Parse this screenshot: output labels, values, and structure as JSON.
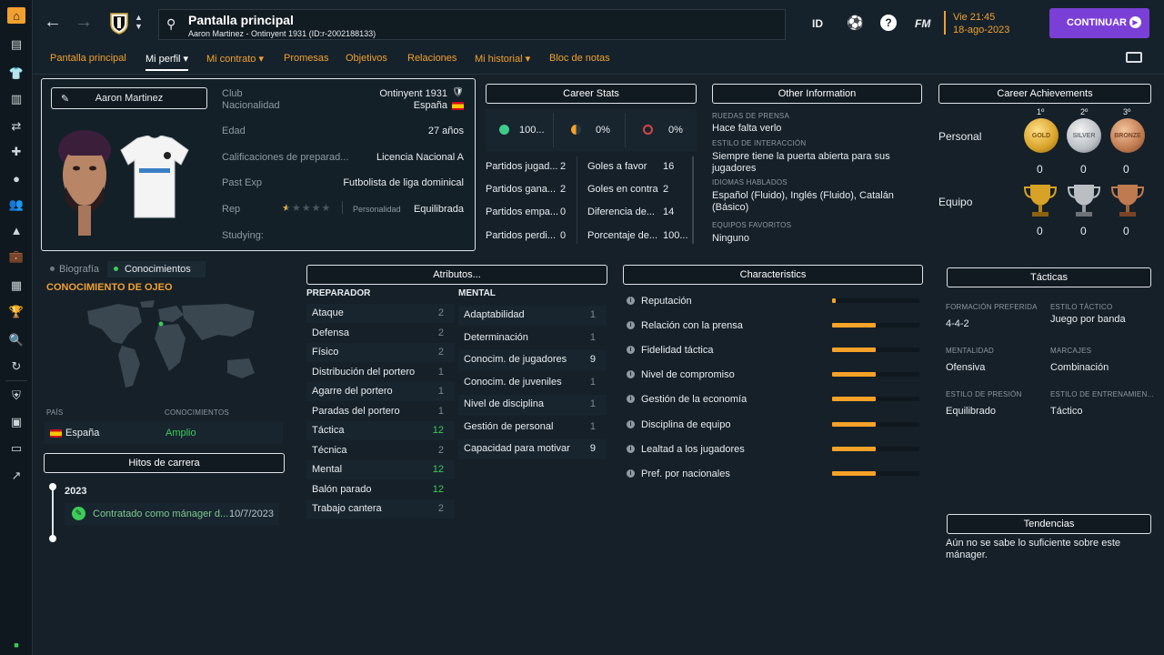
{
  "rail": {
    "icons": [
      "home-icon",
      "inbox-icon",
      "squad-icon",
      "tactics-icon",
      "transfers-icon",
      "medical-icon",
      "match-icon",
      "staff-icon",
      "training-icon",
      "finances-icon",
      "calendar-icon",
      "trophy-icon",
      "scout-icon",
      "refresh-icon",
      "club-icon",
      "briefcase-icon",
      "id-card-icon",
      "trend-icon"
    ]
  },
  "header": {
    "title": "Pantalla principal",
    "subtitle": "Aaron Martinez - Ontinyent 1931 (ID:r-2002188133)",
    "id_label": "ID",
    "help_label": "?",
    "fm_label": "FM",
    "date_line1": "Vie 21:45",
    "date_line2": "18-ago-2023",
    "continue_label": "CONTINUAR"
  },
  "tabs": [
    {
      "label": "Pantalla principal"
    },
    {
      "label": "Mi perfil ▾"
    },
    {
      "label": "Mi contrato ▾"
    },
    {
      "label": "Promesas"
    },
    {
      "label": "Objetivos"
    },
    {
      "label": "Relaciones"
    },
    {
      "label": "Mi historial ▾"
    },
    {
      "label": "Bloc de notas"
    }
  ],
  "profile": {
    "name": "Aaron Martinez",
    "club_label": "Club",
    "club_value": "Ontinyent 1931",
    "nat_label": "Nacionalidad",
    "nat_value": "España",
    "age_label": "Edad",
    "age_value": "27 años",
    "coach_label": "Calificaciones de preparad...",
    "coach_value": "Licencia Nacional A",
    "pastexp_label": "Past Exp",
    "pastexp_value": "Futbolista de liga dominical",
    "rep_label": "Rep",
    "rep_stars": 0.5,
    "personality_label": "Personalidad",
    "personality_value": "Equilibrada",
    "studying_label": "Studying:"
  },
  "career_stats": {
    "title": "Career Stats",
    "win_pct": "100...",
    "draw_pct": "0%",
    "loss_pct": "0%",
    "left": [
      {
        "label": "Partidos jugad...",
        "value": "2"
      },
      {
        "label": "Partidos gana...",
        "value": "2"
      },
      {
        "label": "Partidos empa...",
        "value": "0"
      },
      {
        "label": "Partidos perdi...",
        "value": "0"
      }
    ],
    "right": [
      {
        "label": "Goles a favor",
        "value": "16"
      },
      {
        "label": "Goles en contra",
        "value": "2"
      },
      {
        "label": "Diferencia de...",
        "value": "14"
      },
      {
        "label": "Porcentaje de...",
        "value": "100..."
      }
    ]
  },
  "other_info": {
    "title": "Other Information",
    "items": [
      {
        "cap": "RUEDAS DE PRENSA",
        "val": "Hace falta verlo"
      },
      {
        "cap": "ESTILO DE INTERACCIÓN",
        "val": "Siempre tiene la puerta abierta para sus jugadores"
      },
      {
        "cap": "IDIOMAS HABLADOS",
        "val": "Español (Fluido), Inglés (Fluido), Catalán (Básico)"
      },
      {
        "cap": "EQUIPOS FAVORITOS",
        "val": "Ninguno"
      }
    ]
  },
  "achievements": {
    "title": "Career Achievements",
    "places": [
      "1º",
      "2º",
      "3º"
    ],
    "personal_label": "Personal",
    "team_label": "Equipo",
    "medals": [
      "GOLD",
      "SILVER",
      "BRONZE"
    ],
    "personal": [
      "0",
      "0",
      "0"
    ],
    "team": [
      "0",
      "0",
      "0"
    ]
  },
  "knowledge": {
    "tab1": "Biografía",
    "tab2": "Conocimientos",
    "title": "CONOCIMIENTO DE OJEO",
    "col1": "PAÍS",
    "col2": "CONOCIMIENTOS",
    "country": "España",
    "level": "Amplio"
  },
  "milestones": {
    "title": "Hitos de carrera",
    "year": "2023",
    "event": "Contratado como mánager d...",
    "date": "10/7/2023"
  },
  "attributes": {
    "title": "Atributos...",
    "coach_head": "PREPARADOR",
    "mental_head": "MENTAL",
    "coach": [
      {
        "n": "Ataque",
        "v": "2"
      },
      {
        "n": "Defensa",
        "v": "2"
      },
      {
        "n": "Físico",
        "v": "2"
      },
      {
        "n": "Distribución del portero",
        "v": "1"
      },
      {
        "n": "Agarre del portero",
        "v": "1"
      },
      {
        "n": "Paradas del portero",
        "v": "1"
      },
      {
        "n": "Táctica",
        "v": "12"
      },
      {
        "n": "Técnica",
        "v": "2"
      },
      {
        "n": "Mental",
        "v": "12"
      },
      {
        "n": "Balón parado",
        "v": "12"
      },
      {
        "n": "Trabajo cantera",
        "v": "2"
      }
    ],
    "mental": [
      {
        "n": "Adaptabilidad",
        "v": "1"
      },
      {
        "n": "Determinación",
        "v": "1"
      },
      {
        "n": "Conocim. de jugadores",
        "v": "9"
      },
      {
        "n": "Conocim. de juveniles",
        "v": "1"
      },
      {
        "n": "Nivel de disciplina",
        "v": "1"
      },
      {
        "n": "Gestión de personal",
        "v": "1"
      },
      {
        "n": "Capacidad para motivar",
        "v": "9"
      }
    ]
  },
  "characteristics": {
    "title": "Characteristics",
    "items": [
      {
        "n": "Reputación",
        "level": 0.04
      },
      {
        "n": "Relación con la prensa",
        "level": 0.5
      },
      {
        "n": "Fidelidad táctica",
        "level": 0.5
      },
      {
        "n": "Nivel de compromiso",
        "level": 0.5
      },
      {
        "n": "Gestión de la economía",
        "level": 0.5
      },
      {
        "n": "Disciplina de equipo",
        "level": 0.5
      },
      {
        "n": "Lealtad a los jugadores",
        "level": 0.5
      },
      {
        "n": "Pref. por nacionales",
        "level": 0.5
      }
    ]
  },
  "tactics": {
    "title": "Tácticas",
    "items": [
      {
        "cap": "FORMACIÓN PREFERIDA",
        "val": "4-4-2"
      },
      {
        "cap": "ESTILO TÁCTICO",
        "val": "Juego por banda"
      },
      {
        "cap": "MENTALIDAD",
        "val": "Ofensiva"
      },
      {
        "cap": "MARCAJES",
        "val": "Combinación"
      },
      {
        "cap": "ESTILO DE PRESIÓN",
        "val": "Equilibrado"
      },
      {
        "cap": "ESTILO DE ENTRENAMIEN...",
        "val": "Táctico"
      }
    ]
  },
  "trends": {
    "title": "Tendencias",
    "text": "Aún no se sabe lo suficiente sobre este mánager."
  },
  "colors": {
    "accent": "#f0a030",
    "continue": "#7a3fd6",
    "good": "#3ecb5a",
    "bar": "#f6a228"
  }
}
